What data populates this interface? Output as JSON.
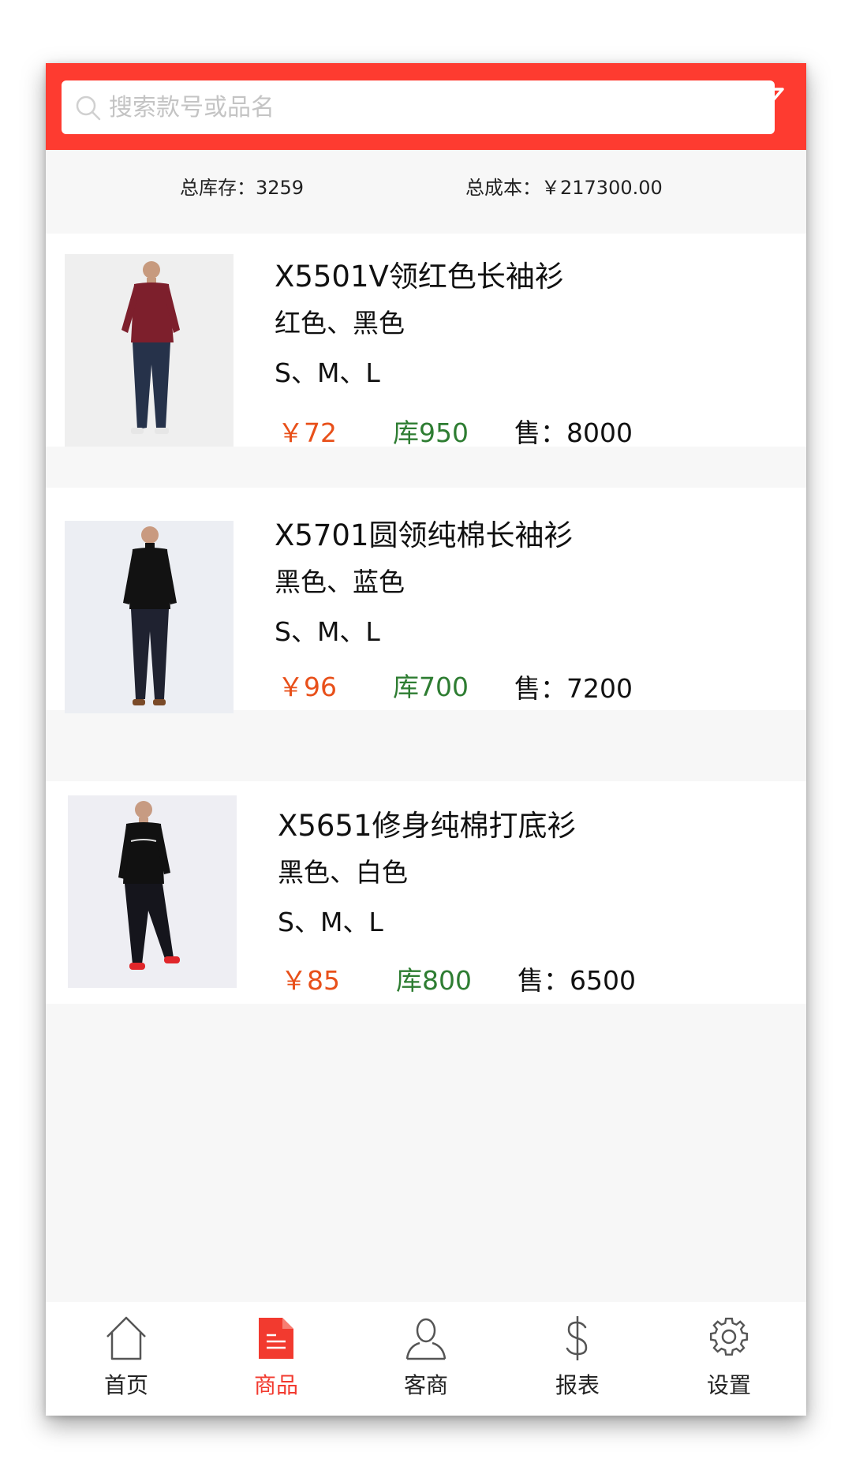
{
  "search": {
    "placeholder": "搜索款号或品名"
  },
  "summary": {
    "total_stock": "总库存：3259",
    "total_cost": "总成本：￥217300.00"
  },
  "products": [
    {
      "title": "X5501V领红色长袖衫",
      "colors": "红色、黑色",
      "sizes": "S、M、L",
      "price": "￥72",
      "stock": "库950",
      "sold": "售：8000"
    },
    {
      "title": "X5701圆领纯棉长袖衫",
      "colors": "黑色、蓝色",
      "sizes": "S、M、L",
      "price": "￥96",
      "stock": "库700",
      "sold": "售：7200"
    },
    {
      "title": "X5651修身纯棉打底衫",
      "colors": "黑色、白色",
      "sizes": "S、M、L",
      "price": "￥85",
      "stock": "库800",
      "sold": "售：6500"
    }
  ],
  "tabs": [
    {
      "label": "首页",
      "icon": "home-icon",
      "active": false
    },
    {
      "label": "商品",
      "icon": "document-icon",
      "active": true
    },
    {
      "label": "客商",
      "icon": "person-icon",
      "active": false
    },
    {
      "label": "报表",
      "icon": "dollar-icon",
      "active": false
    },
    {
      "label": "设置",
      "icon": "gear-icon",
      "active": false
    }
  ],
  "colors": {
    "brand": "#fe3b30",
    "price": "#e8501a",
    "stock": "#2e7d32",
    "active_tab": "#f23a2f"
  }
}
